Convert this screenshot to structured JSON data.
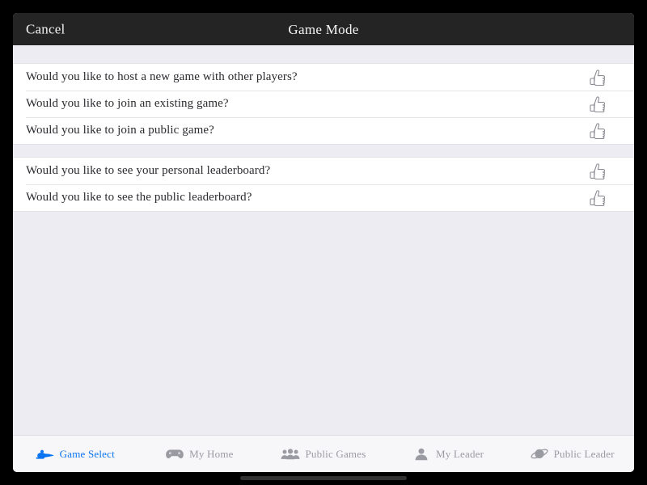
{
  "nav": {
    "cancel_label": "Cancel",
    "title": "Game Mode"
  },
  "list": {
    "sections": [
      {
        "rows": [
          {
            "label": "Would you like to host a new game with other players?",
            "accessory_icon": "thumbs-up-icon"
          },
          {
            "label": "Would you like to join an existing game?",
            "accessory_icon": "thumbs-up-icon"
          },
          {
            "label": "Would you like to join a public game?",
            "accessory_icon": "thumbs-up-icon"
          }
        ]
      },
      {
        "rows": [
          {
            "label": "Would you like to see your personal leaderboard?",
            "accessory_icon": "thumbs-up-icon"
          },
          {
            "label": "Would you like to see the public leaderboard?",
            "accessory_icon": "thumbs-up-icon"
          }
        ]
      }
    ]
  },
  "tab_bar": {
    "active_index": 0,
    "active_color": "#0a74f0",
    "inactive_color": "#9a9aa2",
    "items": [
      {
        "label": "Game Select",
        "icon": "genie-lamp-icon"
      },
      {
        "label": "My Home",
        "icon": "gamepad-icon"
      },
      {
        "label": "Public Games",
        "icon": "people-group-icon"
      },
      {
        "label": "My Leader",
        "icon": "person-icon"
      },
      {
        "label": "Public Leader",
        "icon": "planet-icon"
      }
    ]
  }
}
